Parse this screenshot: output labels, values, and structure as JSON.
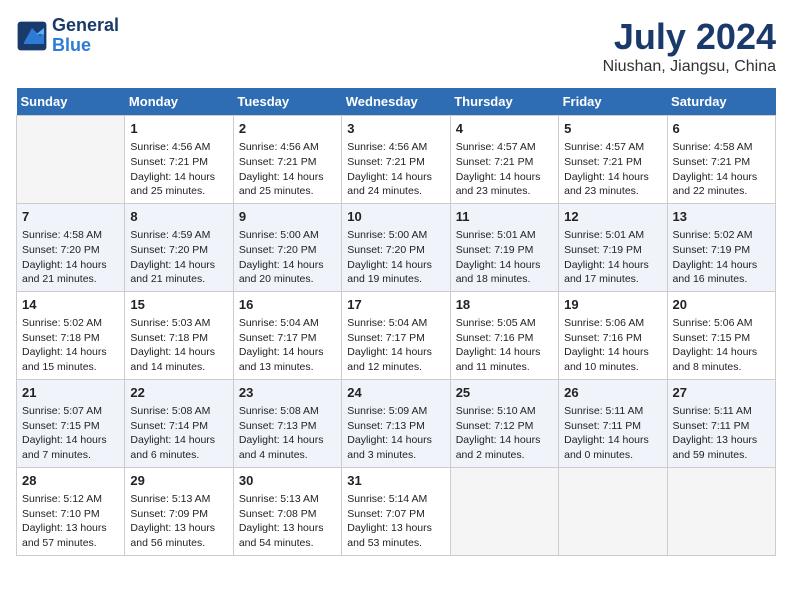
{
  "header": {
    "logo_line1": "General",
    "logo_line2": "Blue",
    "title": "July 2024",
    "subtitle": "Niushan, Jiangsu, China"
  },
  "weekdays": [
    "Sunday",
    "Monday",
    "Tuesday",
    "Wednesday",
    "Thursday",
    "Friday",
    "Saturday"
  ],
  "weeks": [
    [
      {
        "day": "",
        "info": ""
      },
      {
        "day": "1",
        "info": "Sunrise: 4:56 AM\nSunset: 7:21 PM\nDaylight: 14 hours\nand 25 minutes."
      },
      {
        "day": "2",
        "info": "Sunrise: 4:56 AM\nSunset: 7:21 PM\nDaylight: 14 hours\nand 25 minutes."
      },
      {
        "day": "3",
        "info": "Sunrise: 4:56 AM\nSunset: 7:21 PM\nDaylight: 14 hours\nand 24 minutes."
      },
      {
        "day": "4",
        "info": "Sunrise: 4:57 AM\nSunset: 7:21 PM\nDaylight: 14 hours\nand 23 minutes."
      },
      {
        "day": "5",
        "info": "Sunrise: 4:57 AM\nSunset: 7:21 PM\nDaylight: 14 hours\nand 23 minutes."
      },
      {
        "day": "6",
        "info": "Sunrise: 4:58 AM\nSunset: 7:21 PM\nDaylight: 14 hours\nand 22 minutes."
      }
    ],
    [
      {
        "day": "7",
        "info": "Sunrise: 4:58 AM\nSunset: 7:20 PM\nDaylight: 14 hours\nand 21 minutes."
      },
      {
        "day": "8",
        "info": "Sunrise: 4:59 AM\nSunset: 7:20 PM\nDaylight: 14 hours\nand 21 minutes."
      },
      {
        "day": "9",
        "info": "Sunrise: 5:00 AM\nSunset: 7:20 PM\nDaylight: 14 hours\nand 20 minutes."
      },
      {
        "day": "10",
        "info": "Sunrise: 5:00 AM\nSunset: 7:20 PM\nDaylight: 14 hours\nand 19 minutes."
      },
      {
        "day": "11",
        "info": "Sunrise: 5:01 AM\nSunset: 7:19 PM\nDaylight: 14 hours\nand 18 minutes."
      },
      {
        "day": "12",
        "info": "Sunrise: 5:01 AM\nSunset: 7:19 PM\nDaylight: 14 hours\nand 17 minutes."
      },
      {
        "day": "13",
        "info": "Sunrise: 5:02 AM\nSunset: 7:19 PM\nDaylight: 14 hours\nand 16 minutes."
      }
    ],
    [
      {
        "day": "14",
        "info": "Sunrise: 5:02 AM\nSunset: 7:18 PM\nDaylight: 14 hours\nand 15 minutes."
      },
      {
        "day": "15",
        "info": "Sunrise: 5:03 AM\nSunset: 7:18 PM\nDaylight: 14 hours\nand 14 minutes."
      },
      {
        "day": "16",
        "info": "Sunrise: 5:04 AM\nSunset: 7:17 PM\nDaylight: 14 hours\nand 13 minutes."
      },
      {
        "day": "17",
        "info": "Sunrise: 5:04 AM\nSunset: 7:17 PM\nDaylight: 14 hours\nand 12 minutes."
      },
      {
        "day": "18",
        "info": "Sunrise: 5:05 AM\nSunset: 7:16 PM\nDaylight: 14 hours\nand 11 minutes."
      },
      {
        "day": "19",
        "info": "Sunrise: 5:06 AM\nSunset: 7:16 PM\nDaylight: 14 hours\nand 10 minutes."
      },
      {
        "day": "20",
        "info": "Sunrise: 5:06 AM\nSunset: 7:15 PM\nDaylight: 14 hours\nand 8 minutes."
      }
    ],
    [
      {
        "day": "21",
        "info": "Sunrise: 5:07 AM\nSunset: 7:15 PM\nDaylight: 14 hours\nand 7 minutes."
      },
      {
        "day": "22",
        "info": "Sunrise: 5:08 AM\nSunset: 7:14 PM\nDaylight: 14 hours\nand 6 minutes."
      },
      {
        "day": "23",
        "info": "Sunrise: 5:08 AM\nSunset: 7:13 PM\nDaylight: 14 hours\nand 4 minutes."
      },
      {
        "day": "24",
        "info": "Sunrise: 5:09 AM\nSunset: 7:13 PM\nDaylight: 14 hours\nand 3 minutes."
      },
      {
        "day": "25",
        "info": "Sunrise: 5:10 AM\nSunset: 7:12 PM\nDaylight: 14 hours\nand 2 minutes."
      },
      {
        "day": "26",
        "info": "Sunrise: 5:11 AM\nSunset: 7:11 PM\nDaylight: 14 hours\nand 0 minutes."
      },
      {
        "day": "27",
        "info": "Sunrise: 5:11 AM\nSunset: 7:11 PM\nDaylight: 13 hours\nand 59 minutes."
      }
    ],
    [
      {
        "day": "28",
        "info": "Sunrise: 5:12 AM\nSunset: 7:10 PM\nDaylight: 13 hours\nand 57 minutes."
      },
      {
        "day": "29",
        "info": "Sunrise: 5:13 AM\nSunset: 7:09 PM\nDaylight: 13 hours\nand 56 minutes."
      },
      {
        "day": "30",
        "info": "Sunrise: 5:13 AM\nSunset: 7:08 PM\nDaylight: 13 hours\nand 54 minutes."
      },
      {
        "day": "31",
        "info": "Sunrise: 5:14 AM\nSunset: 7:07 PM\nDaylight: 13 hours\nand 53 minutes."
      },
      {
        "day": "",
        "info": ""
      },
      {
        "day": "",
        "info": ""
      },
      {
        "day": "",
        "info": ""
      }
    ]
  ]
}
